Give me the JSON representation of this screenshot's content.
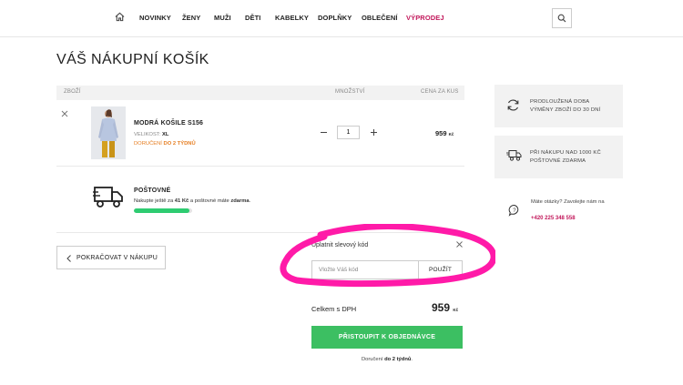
{
  "nav": {
    "items": [
      "NOVINKY",
      "ŽENY",
      "MUŽI",
      "DĚTI",
      "KABELKY",
      "DOPLŇKY",
      "OBLEČENÍ",
      "VÝPRODEJ"
    ]
  },
  "page": {
    "title": "VÁŠ NÁKUPNÍ KOŠÍK"
  },
  "cart": {
    "headers": {
      "product": "ZBOŽÍ",
      "quantity": "MNOŽSTVÍ",
      "unit_price": "CENA ZA KUS"
    },
    "item": {
      "name": "MODRÁ KOŠILE S156",
      "size_label": "VELIKOST:",
      "size_value": "XL",
      "delivery_label": "DORUČENÍ",
      "delivery_value": "DO 2 TÝDNŮ",
      "quantity": "1",
      "price": "959",
      "currency": "Kč"
    },
    "shipping": {
      "title": "POŠTOVNÉ",
      "text_1": "Nakupte ještě za ",
      "amount": "41 Kč",
      "text_2": " a poštovné máte ",
      "free": "zdarma",
      "text_3": ".",
      "progress_percent": 96
    }
  },
  "continue_label": "POKRAČOVAT V NÁKUPU",
  "coupon": {
    "label": "Uplatnit slevový kód",
    "placeholder": "Vložte Váš kód",
    "apply_label": "POUŽÍT"
  },
  "summary": {
    "total_label": "Celkem s DPH",
    "total_value": "959",
    "currency": "Kč",
    "checkout_label": "PŘISTOUPIT K OBJEDNÁVCE",
    "delivery_prefix": "Doručení ",
    "delivery_value": "do 2 týdnů",
    "delivery_suffix": "."
  },
  "sidebar": {
    "return_line1": "PRODLOUŽENÁ DOBA",
    "return_line2": "VÝMĚNY ZBOŽÍ DO 30 DNÍ",
    "shipping_line1": "PŘI NÁKUPU NAD 1000 KČ",
    "shipping_line2": "POŠTOVNÉ ZDARMA",
    "help_text": "Máte otázky? Zavolejte nám na",
    "help_phone": "+420 225 348 558"
  },
  "colors": {
    "accent": "#c2185b",
    "checkout": "#3cbf62",
    "highlight": "#ff1aa8",
    "warning": "#e67e22"
  }
}
